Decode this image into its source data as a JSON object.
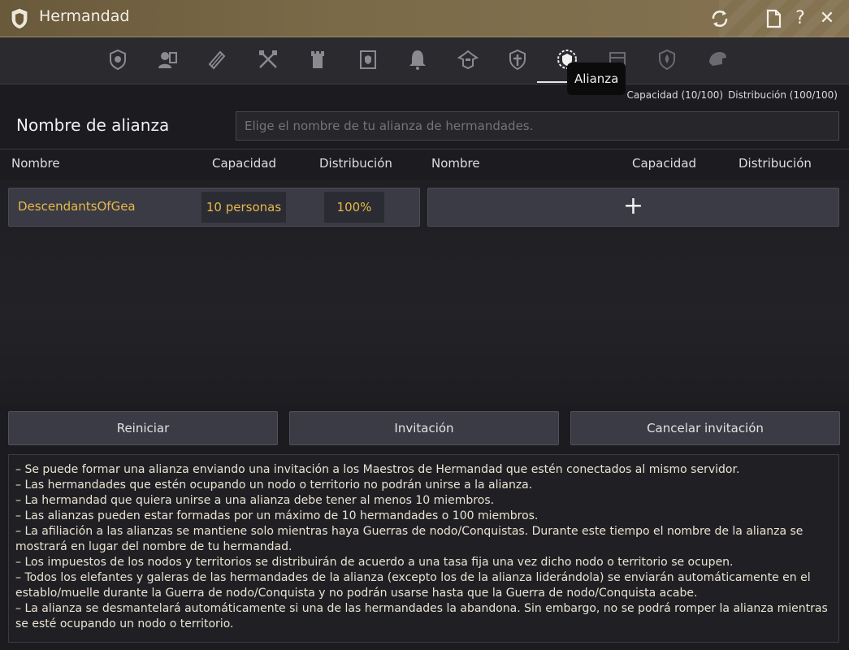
{
  "window": {
    "title": "Hermandad"
  },
  "tabs": [
    {
      "icon": "guild-crest-icon"
    },
    {
      "icon": "members-icon"
    },
    {
      "icon": "scroll-quest-icon"
    },
    {
      "icon": "crossed-weapons-icon"
    },
    {
      "icon": "tower-icon"
    },
    {
      "icon": "notice-board-icon"
    },
    {
      "icon": "bell-icon"
    },
    {
      "icon": "helmet-icon"
    },
    {
      "icon": "shield-icon"
    },
    {
      "icon": "alliance-crest-icon",
      "active": true,
      "tooltip": "Alianza"
    },
    {
      "icon": "storage-icon"
    },
    {
      "icon": "fleur-emblem-icon"
    },
    {
      "icon": "mount-icon"
    }
  ],
  "capacity_info": {
    "capacity": "Capacidad (10/100)",
    "distribution": "Distribución (100/100)"
  },
  "alliance_name": {
    "label": "Nombre de alianza",
    "placeholder": "Elige el nombre de tu alianza de hermandades."
  },
  "columns_left": {
    "name": "Nombre",
    "capacity": "Capacidad",
    "distribution": "Distribución"
  },
  "columns_right": {
    "name": "Nombre",
    "capacity": "Capacidad",
    "distribution": "Distribución"
  },
  "guild_rows": [
    {
      "name": "DescendantsOfGea",
      "capacity": "10 personas",
      "distribution": "100%"
    }
  ],
  "add_slot": {
    "label": "+"
  },
  "buttons": {
    "reset": "Reiniciar",
    "invite": "Invitación",
    "cancel_invite": "Cancelar invitación"
  },
  "info_lines": [
    "– Se puede formar una alianza enviando una invitación a los Maestros de Hermandad que estén conectados al mismo servidor.",
    "– Las hermandades que estén ocupando un nodo o territorio no podrán unirse a la alianza.",
    "– La hermandad que quiera unirse a una alianza debe tener al menos 10 miembros.",
    "– Las alianzas pueden estar formadas por un máximo de 10 hermandades o 100 miembros.",
    "– La afiliación a las alianzas se mantiene solo mientras haya Guerras de nodo/Conquistas. Durante este tiempo el nombre de la alianza se mostrará en lugar del nombre de tu hermandad.",
    "– Los impuestos de los nodos y territorios se distribuirán de acuerdo a una tasa fija una vez dicho nodo o territorio se ocupen.",
    "– Todos los elefantes y galeras de las hermandades de la alianza (excepto los de la alianza liderándola) se enviarán automáticamente en el establo/muelle durante la Guerra de nodo/Conquista y no podrán usarse hasta que la Guerra de nodo/Conquista acabe.",
    "– La alianza se desmantelará automáticamente si una de las hermandades la abandona. Sin embargo, no se podrá romper la alianza mientras se esté ocupando un nodo o territorio."
  ]
}
